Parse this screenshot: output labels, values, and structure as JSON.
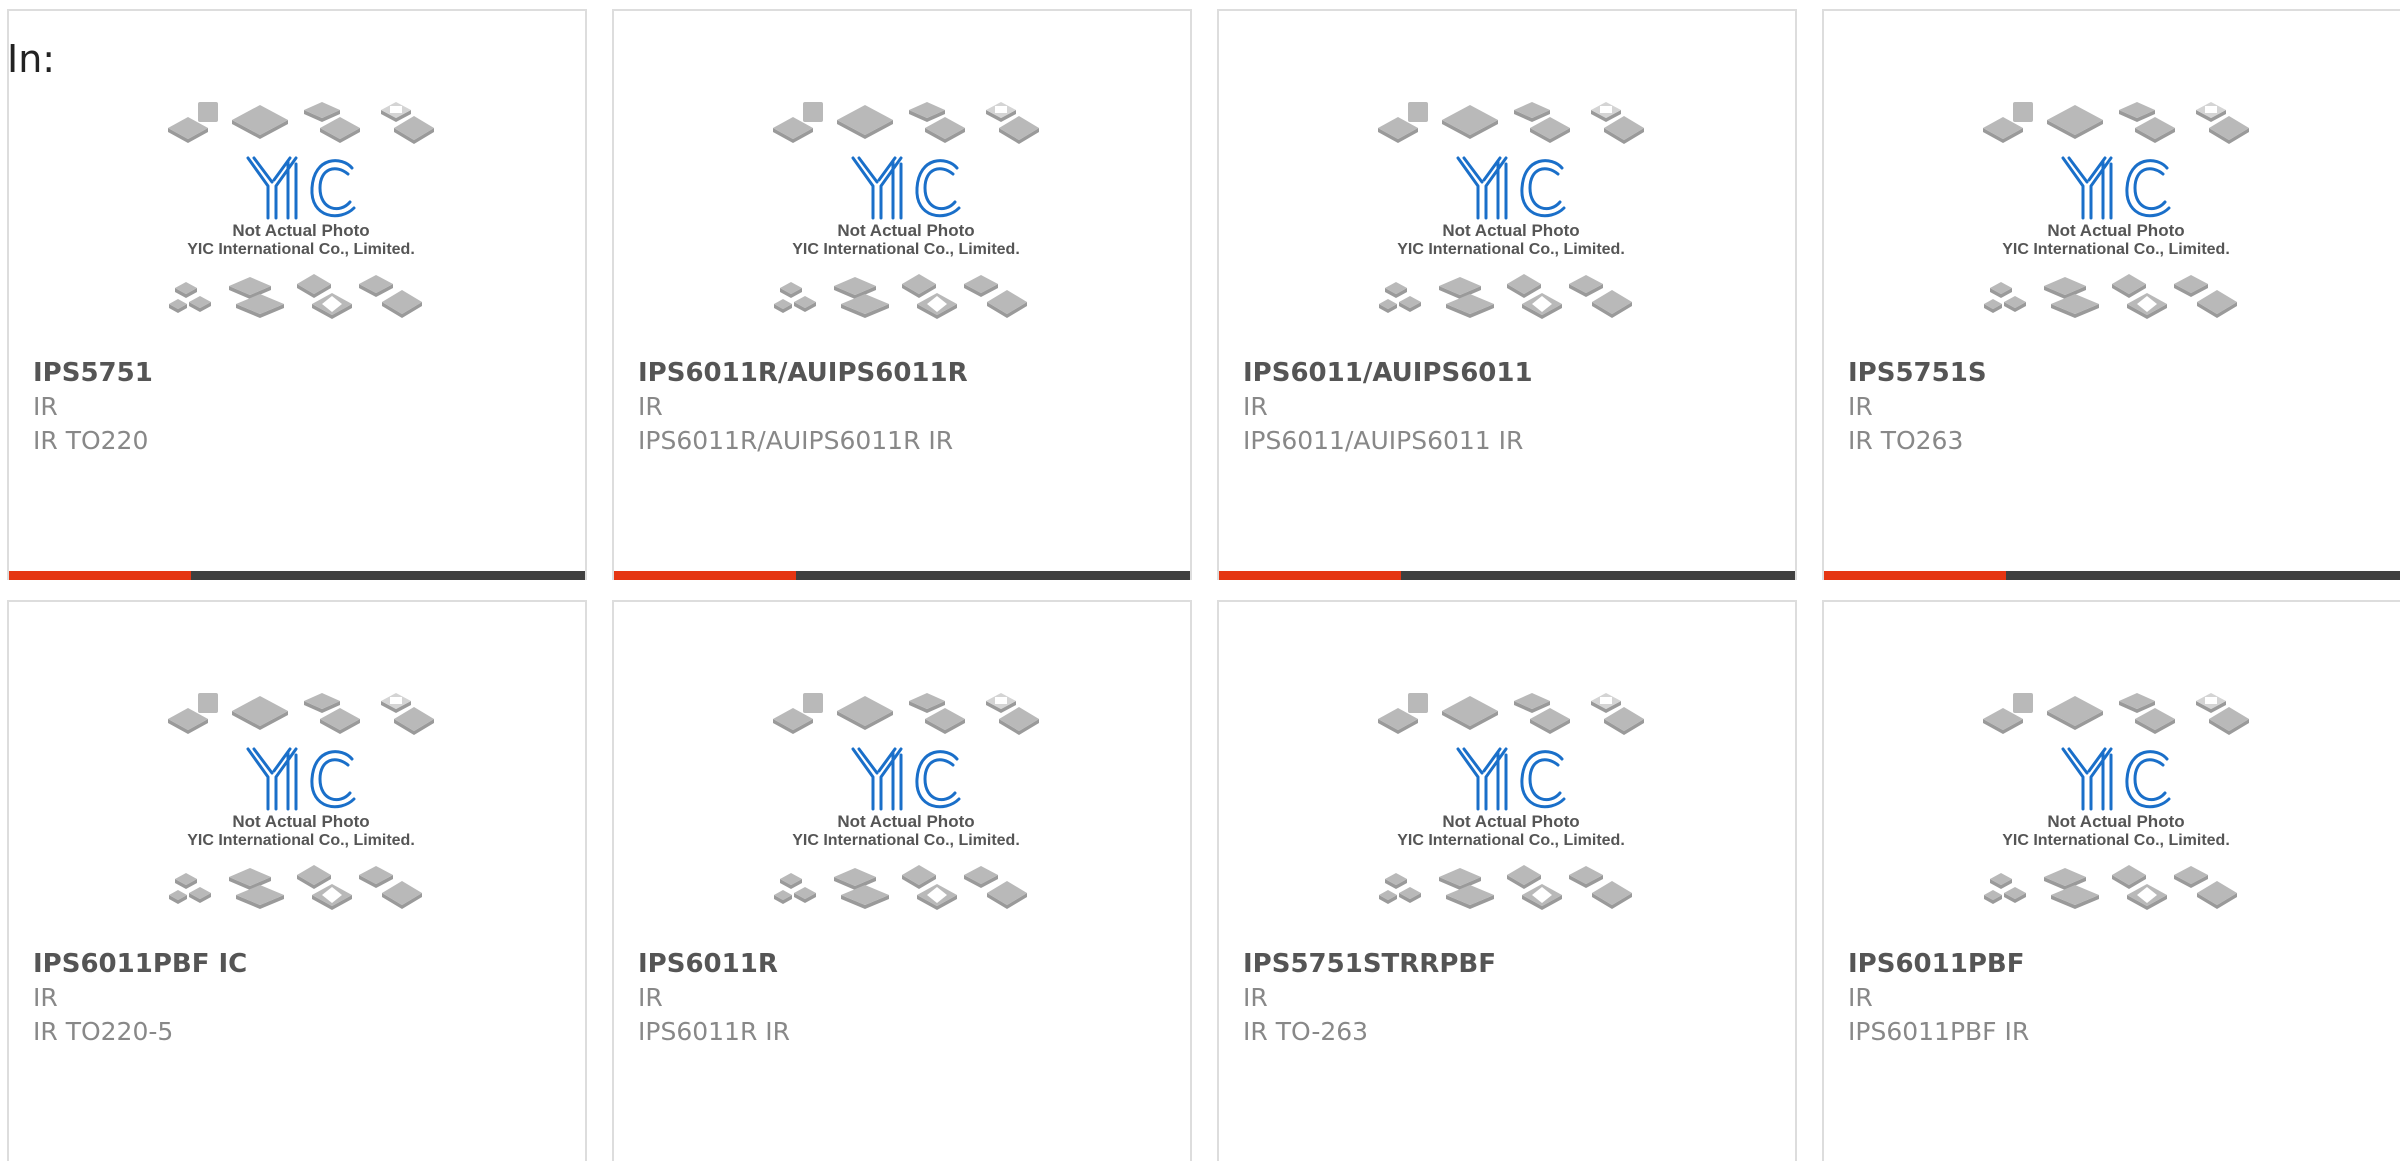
{
  "header": {
    "label": "In:"
  },
  "placeholder_image": {
    "line1": "Not Actual Photo",
    "line2": "YIC International Co., Limited.",
    "logo": "YIC",
    "icon": "chip-packages-icon"
  },
  "colors": {
    "accent": "#e53512",
    "bar": "#3f3f3f",
    "logo": "#1a6fc9",
    "title": "#555555",
    "text": "#888888",
    "border": "#dddddd"
  },
  "products": [
    {
      "name": "IPS5751",
      "brand": "IR",
      "desc": "IR TO220"
    },
    {
      "name": "IPS6011R/AUIPS6011R",
      "brand": "IR",
      "desc": "IPS6011R/AUIPS6011R IR"
    },
    {
      "name": "IPS6011/AUIPS6011",
      "brand": "IR",
      "desc": "IPS6011/AUIPS6011 IR"
    },
    {
      "name": "IPS5751S",
      "brand": "IR",
      "desc": "IR TO263"
    },
    {
      "name": "IPS6011PBF IC",
      "brand": "IR",
      "desc": "IR TO220-5"
    },
    {
      "name": "IPS6011R",
      "brand": "IR",
      "desc": "IPS6011R IR"
    },
    {
      "name": "IPS5751STRRPBF",
      "brand": "IR",
      "desc": "IR TO-263"
    },
    {
      "name": "IPS6011PBF",
      "brand": "IR",
      "desc": "IPS6011PBF IR"
    }
  ]
}
